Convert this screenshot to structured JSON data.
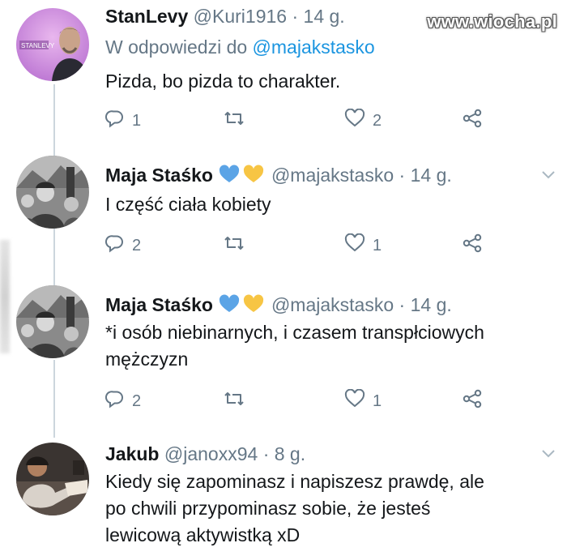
{
  "watermark": "www.wiocha.pl",
  "colors": {
    "text": "#14171a",
    "secondary": "#657786",
    "link": "#1b95e0",
    "thread_line": "#ccd6dd",
    "heart_blue": "#5ba4e6",
    "heart_yellow": "#f7c544"
  },
  "tweets": [
    {
      "name": "StanLevy",
      "handle": "@Kuri1916",
      "dot": "·",
      "time": "14 g.",
      "reply_prefix": "W odpowiedzi do",
      "reply_mention": "@majakstasko",
      "text": "Pizda, bo pizda to charakter.",
      "avatar_caption": "STANLEVY",
      "actions": {
        "replies": "1",
        "retweets": "",
        "likes": "2"
      },
      "icons": [
        "reply-icon",
        "retweet-icon",
        "heart-icon",
        "share-icon"
      ]
    },
    {
      "name": "Maja Staśko",
      "handle": "@majakstasko",
      "dot": "·",
      "time": "14 g.",
      "text": "I część ciała kobiety",
      "actions": {
        "replies": "2",
        "retweets": "",
        "likes": "1"
      },
      "icons": [
        "reply-icon",
        "retweet-icon",
        "heart-icon",
        "share-icon"
      ]
    },
    {
      "name": "Maja Staśko",
      "handle": "@majakstasko",
      "dot": "·",
      "time": "14 g.",
      "text_line1": "*i osób niebinarnych, i czasem transpłciowych",
      "text_line2": "mężczyzn",
      "actions": {
        "replies": "2",
        "retweets": "",
        "likes": "1"
      },
      "icons": [
        "reply-icon",
        "retweet-icon",
        "heart-icon",
        "share-icon"
      ]
    },
    {
      "name": "Jakub",
      "handle": "@janoxx94",
      "dot": "·",
      "time": "8 g.",
      "text_line1": "Kiedy się zapominasz i napiszesz prawdę, ale",
      "text_line2": "po chwili przypominasz sobie, że jesteś",
      "text_line3": "lewicową aktywistką xD"
    }
  ]
}
